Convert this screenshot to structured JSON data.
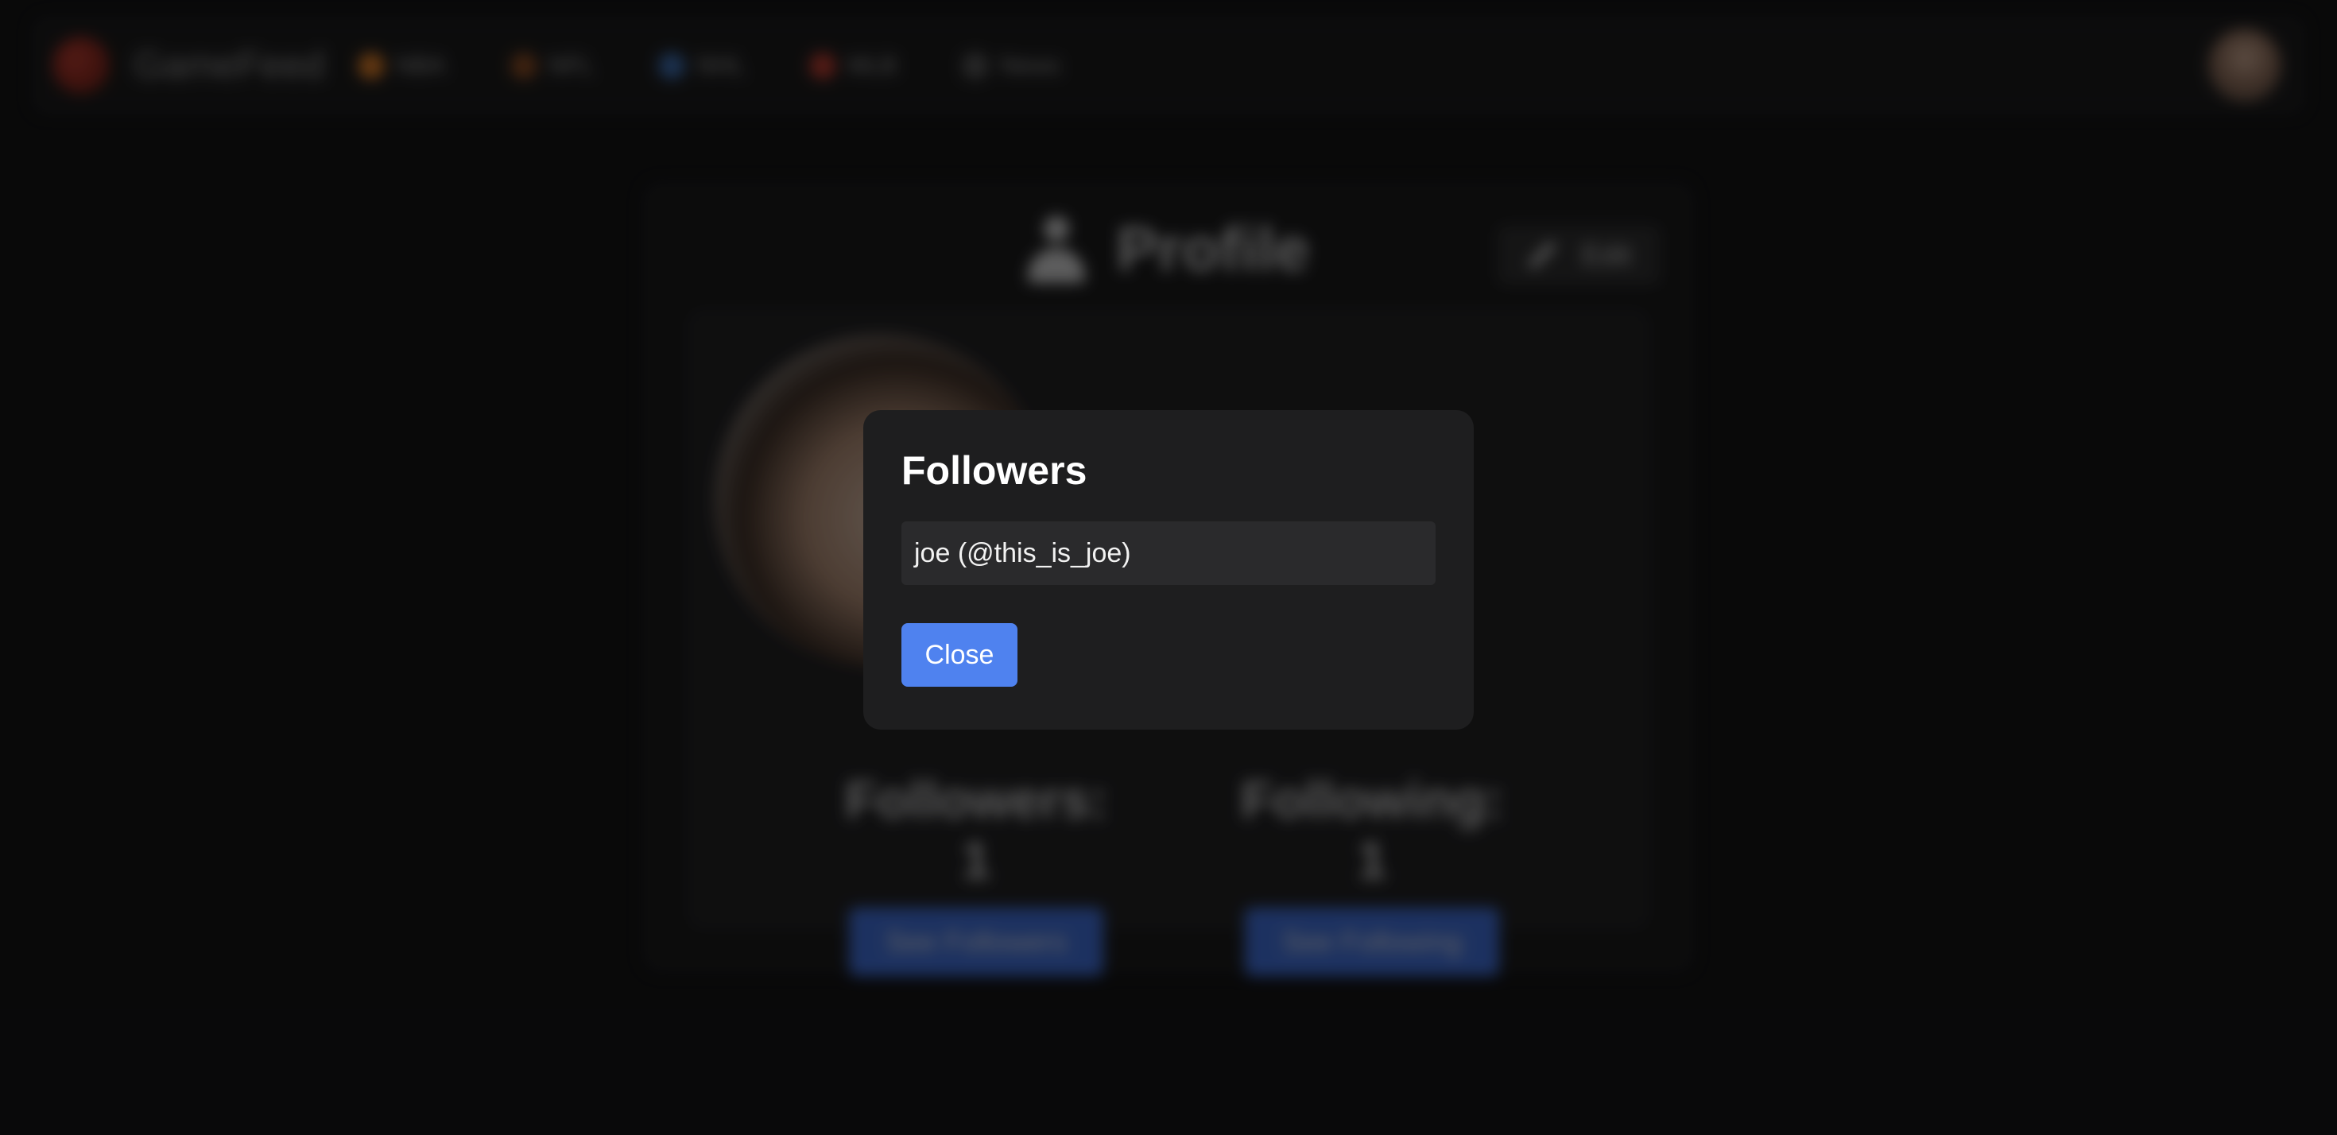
{
  "nav": {
    "brand": "GameFeed",
    "links": [
      {
        "label": "NBA",
        "icon": "basketball-icon",
        "color": "#e67e22"
      },
      {
        "label": "NFL",
        "icon": "football-icon",
        "color": "#8e4a1c"
      },
      {
        "label": "NHL",
        "icon": "hockey-icon",
        "color": "#3b6fb6"
      },
      {
        "label": "MLB",
        "icon": "baseball-icon",
        "color": "#c0392b"
      },
      {
        "label": "News",
        "icon": "news-icon",
        "color": "#555555"
      }
    ]
  },
  "profile": {
    "title": "Profile",
    "edit_label": "Edit",
    "followers_label": "Followers:",
    "followers_count": "1",
    "following_label": "Following:",
    "following_count": "1",
    "see_followers_label": "See Followers",
    "see_following_label": "See Following"
  },
  "modal": {
    "title": "Followers",
    "followers": [
      "joe (@this_is_joe)"
    ],
    "close_label": "Close"
  },
  "colors": {
    "accent": "#4f82ef",
    "modal_bg": "#1e1e1f",
    "page_bg": "#0c0c0d"
  }
}
